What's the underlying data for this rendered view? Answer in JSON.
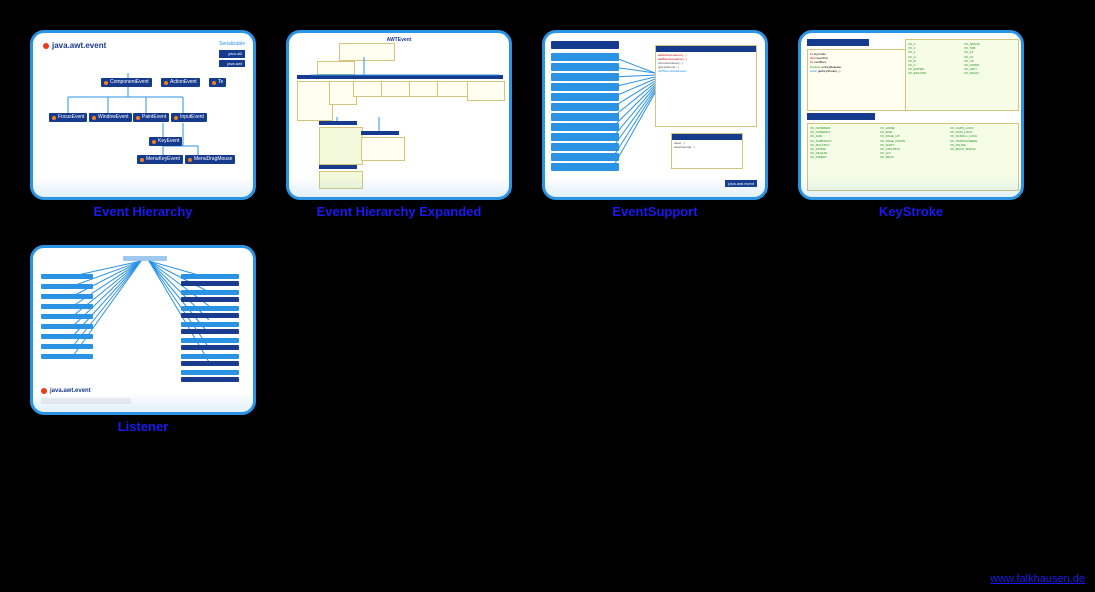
{
  "footer": "www.falkhausen.de",
  "tiles": [
    {
      "caption": "Event Hierarchy"
    },
    {
      "caption": "Event Hierarchy Expanded"
    },
    {
      "caption": "EventSupport"
    },
    {
      "caption": "KeyStroke"
    },
    {
      "caption": "Listener"
    }
  ],
  "thumb1": {
    "heading": "java.awt.event",
    "legend_label": "Serializable",
    "nodes": {
      "ComponentEvent": "ComponentEvent",
      "ActionEvent": "ActionEvent",
      "Te": "Te",
      "FocusEvent": "FocusEvent",
      "WindowEvent": "WindowEvent",
      "PaintEvent": "PaintEvent",
      "InputEvent": "InputEvent",
      "KeyEvent": "KeyEvent",
      "MenuKeyEvent": "MenuKeyEvent",
      "MenuDragMouse": "MenuDragMouse"
    }
  },
  "thumb2": {
    "title": "AWTEvent"
  },
  "thumb5": {
    "heading": "java.awt.event"
  }
}
